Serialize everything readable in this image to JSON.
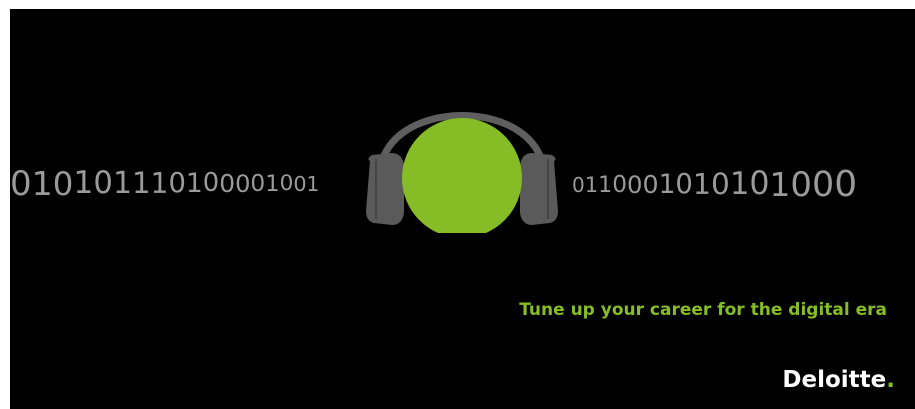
{
  "binary": {
    "left": "010101110100001001",
    "right": "0110001010101000"
  },
  "tagline": "Tune up your career for the digital era",
  "logo": {
    "text": "Deloitte",
    "dot": "."
  },
  "colors": {
    "background": "#000000",
    "accent_green": "#86bc25",
    "binary_gray": "#9a9a9a",
    "headphone_gray": "#5f5f5f"
  },
  "icons": [
    "headphones-icon"
  ]
}
